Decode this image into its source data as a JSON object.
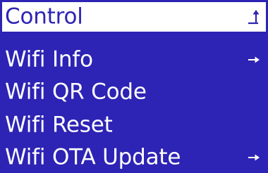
{
  "colors": {
    "background": "#2d23b4",
    "text": "#ffffff",
    "selected_background": "#ffffff",
    "selected_text": "#2d23b4"
  },
  "menu": {
    "items": [
      {
        "label": "Control",
        "icon": "up-arrow-icon",
        "selected": true
      },
      {
        "label": "Wifi Info",
        "icon": "right-arrow-icon",
        "selected": false
      },
      {
        "label": "Wifi QR Code",
        "icon": "",
        "selected": false
      },
      {
        "label": "Wifi Reset",
        "icon": "",
        "selected": false
      },
      {
        "label": "Wifi OTA Update",
        "icon": "right-arrow-icon",
        "selected": false
      }
    ]
  }
}
